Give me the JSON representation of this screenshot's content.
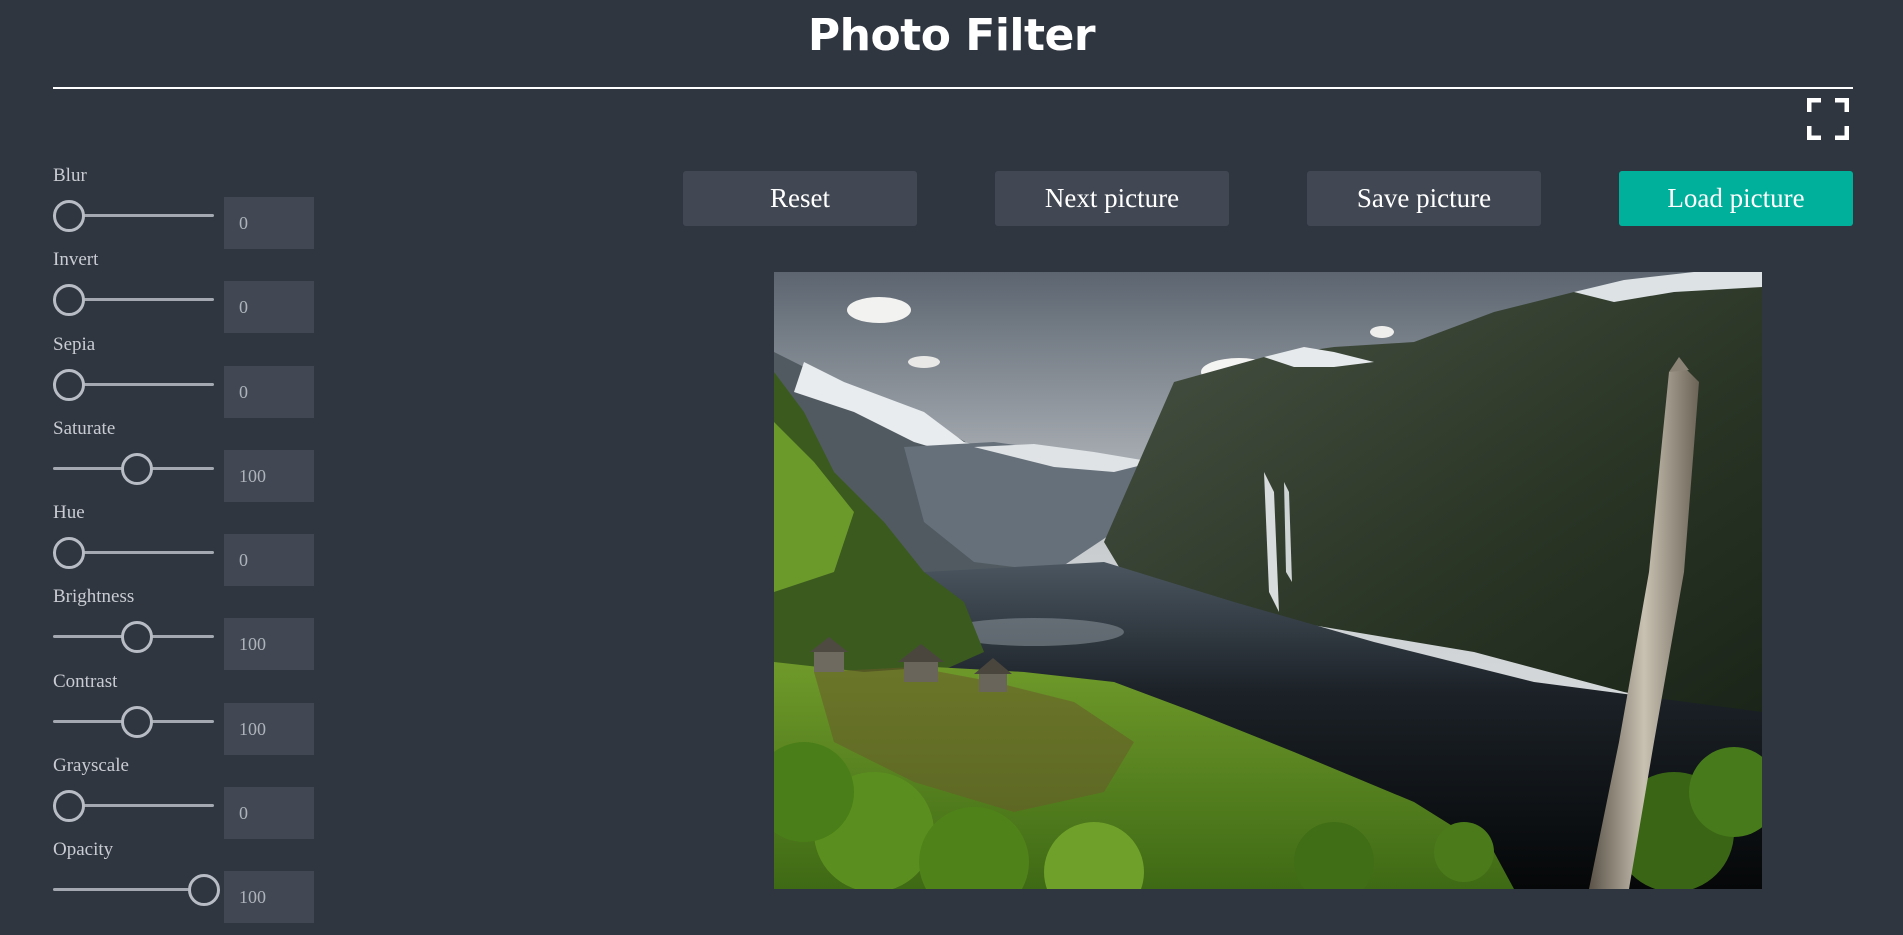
{
  "header": {
    "title": "Photo Filter"
  },
  "filters": [
    {
      "label": "Blur",
      "value": "0",
      "level": 0
    },
    {
      "label": "Invert",
      "value": "0",
      "level": 0
    },
    {
      "label": "Sepia",
      "value": "0",
      "level": 0
    },
    {
      "label": "Saturate",
      "value": "100",
      "level": 0.5
    },
    {
      "label": "Hue",
      "value": "0",
      "level": 0
    },
    {
      "label": "Brightness",
      "value": "100",
      "level": 0.5
    },
    {
      "label": "Contrast",
      "value": "100",
      "level": 0.5
    },
    {
      "label": "Grayscale",
      "value": "0",
      "level": 0
    },
    {
      "label": "Opacity",
      "value": "100",
      "level": 1
    }
  ],
  "buttons": {
    "reset": "Reset",
    "next": "Next picture",
    "save": "Save picture",
    "load": "Load picture"
  },
  "icons": {
    "fullscreen": "fullscreen-icon"
  },
  "colors": {
    "accent": "#00b09b",
    "background": "#2f3640",
    "control": "#414853"
  }
}
